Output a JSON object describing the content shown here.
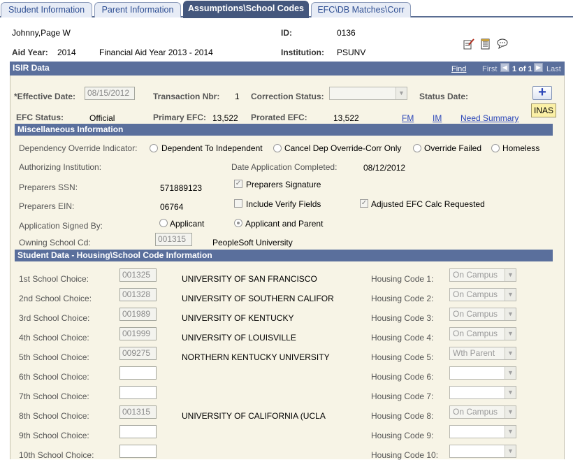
{
  "tabs": [
    {
      "label": "Student Information"
    },
    {
      "label": "Parent Information"
    },
    {
      "label": "Assumptions\\School Codes"
    },
    {
      "label": "EFC\\DB Matches\\Corr"
    }
  ],
  "header": {
    "student_name": "Johnny,Page W",
    "id_label": "ID:",
    "id_value": "0136",
    "aid_year_label": "Aid Year:",
    "aid_year_value": "2014",
    "aid_year_desc": "Financial Aid Year 2013 - 2014",
    "institution_label": "Institution:",
    "institution_value": "PSUNV"
  },
  "isir": {
    "title": "ISIR Data",
    "find": "Find",
    "first": "First",
    "page_of": "1 of 1",
    "last": "Last",
    "effective_date_label": "*Effective Date:",
    "effective_date_value": "08/15/2012",
    "transaction_label": "Transaction Nbr:",
    "transaction_value": "1",
    "correction_status_label": "Correction Status:",
    "status_date_label": "Status Date:",
    "efc_status_label": "EFC Status:",
    "efc_status_value": "Official",
    "primary_efc_label": "Primary EFC:",
    "primary_efc_value": "13,522",
    "prorated_efc_label": "Prorated EFC:",
    "prorated_efc_value": "13,522",
    "fm_link": "FM",
    "im_link": "IM",
    "need_summary_link": "Need Summary",
    "inas_button": "INAS"
  },
  "misc": {
    "title": "Miscellaneous Information",
    "dependency_label": "Dependency Override Indicator:",
    "dependency_options": [
      "Dependent To Independent",
      "Cancel Dep Override-Corr Only",
      "Override Failed",
      "Homeless"
    ],
    "authorizing_label": "Authorizing Institution:",
    "date_completed_label": "Date Application Completed:",
    "date_completed_value": "08/12/2012",
    "preparers_ssn_label": "Preparers SSN:",
    "preparers_ssn_value": "571889123",
    "preparers_signature_label": "Preparers Signature",
    "preparers_ein_label": "Preparers EIN:",
    "preparers_ein_value": "06764",
    "include_verify_label": "Include Verify Fields",
    "adjusted_efc_label": "Adjusted EFC Calc Requested",
    "signed_by_label": "Application Signed By:",
    "signed_by_options": [
      "Applicant",
      "Applicant and Parent"
    ],
    "owning_school_label": "Owning School Cd:",
    "owning_school_code": "001315",
    "owning_school_name": "PeopleSoft University"
  },
  "housing": {
    "title": "Student Data - Housing\\School Code Information",
    "rows": [
      {
        "label": "1st School Choice:",
        "code": "001325",
        "school": "UNIVERSITY OF SAN FRANCISCO",
        "housing_label": "Housing Code 1:",
        "housing": "On Campus"
      },
      {
        "label": "2nd School Choice:",
        "code": "001328",
        "school": "UNIVERSITY OF SOUTHERN CALIFOR",
        "housing_label": "Housing Code 2:",
        "housing": "On Campus"
      },
      {
        "label": "3rd School Choice:",
        "code": "001989",
        "school": "UNIVERSITY OF KENTUCKY",
        "housing_label": "Housing Code 3:",
        "housing": "On Campus"
      },
      {
        "label": "4th School Choice:",
        "code": "001999",
        "school": "UNIVERSITY OF LOUISVILLE",
        "housing_label": "Housing Code 4:",
        "housing": "On Campus"
      },
      {
        "label": "5th School Choice:",
        "code": "009275",
        "school": "NORTHERN KENTUCKY UNIVERSITY",
        "housing_label": "Housing Code 5:",
        "housing": "Wth Parent"
      },
      {
        "label": "6th School Choice:",
        "code": "",
        "school": "",
        "housing_label": "Housing Code 6:",
        "housing": ""
      },
      {
        "label": "7th School Choice:",
        "code": "",
        "school": "",
        "housing_label": "Housing Code 7:",
        "housing": ""
      },
      {
        "label": "8th School Choice:",
        "code": "001315",
        "school": "UNIVERSITY OF CALIFORNIA (UCLA",
        "housing_label": "Housing Code 8:",
        "housing": "On Campus"
      },
      {
        "label": "9th School Choice:",
        "code": "",
        "school": "",
        "housing_label": "Housing Code 9:",
        "housing": ""
      },
      {
        "label": "10th School Choice:",
        "code": "",
        "school": "",
        "housing_label": "Housing Code 10:",
        "housing": ""
      }
    ]
  },
  "icons": [
    "notepad-pencil-icon",
    "document-icon",
    "comment-bubble-icon",
    "add-row-icon",
    "previous-arrow-icon",
    "next-arrow-icon"
  ]
}
